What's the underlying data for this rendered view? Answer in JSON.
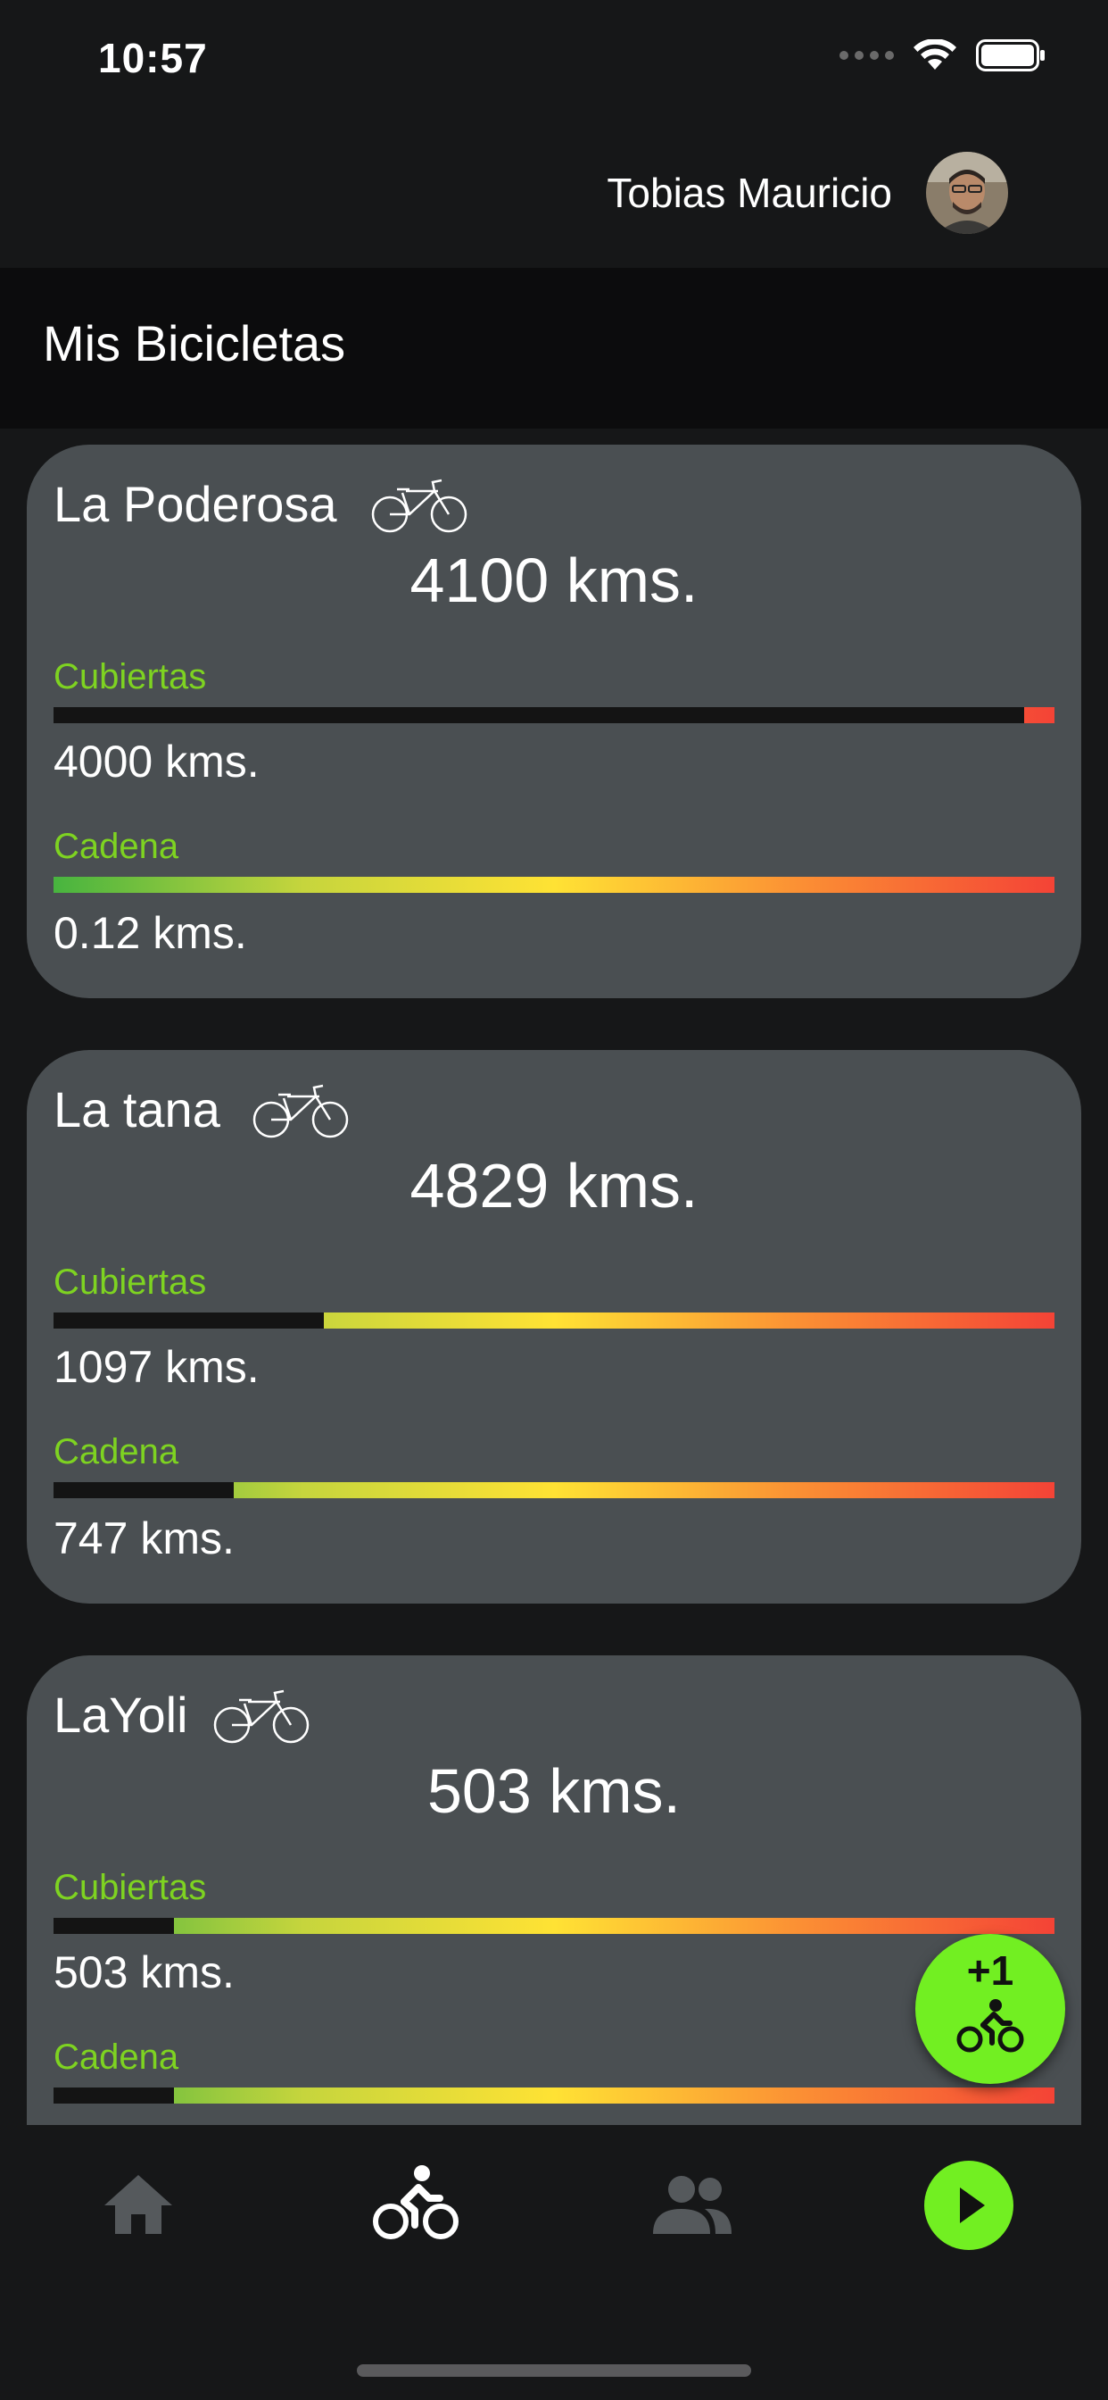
{
  "status_bar": {
    "time": "10:57"
  },
  "user": {
    "name": "Tobias Mauricio"
  },
  "page": {
    "title": "Mis Bicicletas"
  },
  "colors": {
    "accent": "#72ef22",
    "label": "#7ed321",
    "card": "#4a4f52",
    "background": "#161718"
  },
  "bikes": [
    {
      "name": "La Poderosa",
      "total": "4100 kms.",
      "parts": [
        {
          "label": "Cubiertas",
          "km": "4000 kms.",
          "wear_fraction": 0.97
        },
        {
          "label": "Cadena",
          "km": "0.12 kms.",
          "wear_fraction": 0.0
        }
      ]
    },
    {
      "name": "La tana",
      "total": "4829 kms.",
      "parts": [
        {
          "label": "Cubiertas",
          "km": "1097 kms.",
          "wear_fraction": 0.27
        },
        {
          "label": "Cadena",
          "km": "747 kms.",
          "wear_fraction": 0.18
        }
      ]
    },
    {
      "name": "LaYoli",
      "total": "503 kms.",
      "parts": [
        {
          "label": "Cubiertas",
          "km": "503 kms.",
          "wear_fraction": 0.12
        },
        {
          "label": "Cadena",
          "km": "",
          "wear_fraction": 0.12
        }
      ]
    }
  ],
  "fab": {
    "label": "+1",
    "icon": "cyclist-icon"
  },
  "nav": {
    "items": [
      {
        "icon": "home-icon",
        "active": false
      },
      {
        "icon": "cyclist-icon",
        "active": true
      },
      {
        "icon": "people-icon",
        "active": false
      },
      {
        "icon": "play-icon",
        "active": false
      }
    ]
  }
}
